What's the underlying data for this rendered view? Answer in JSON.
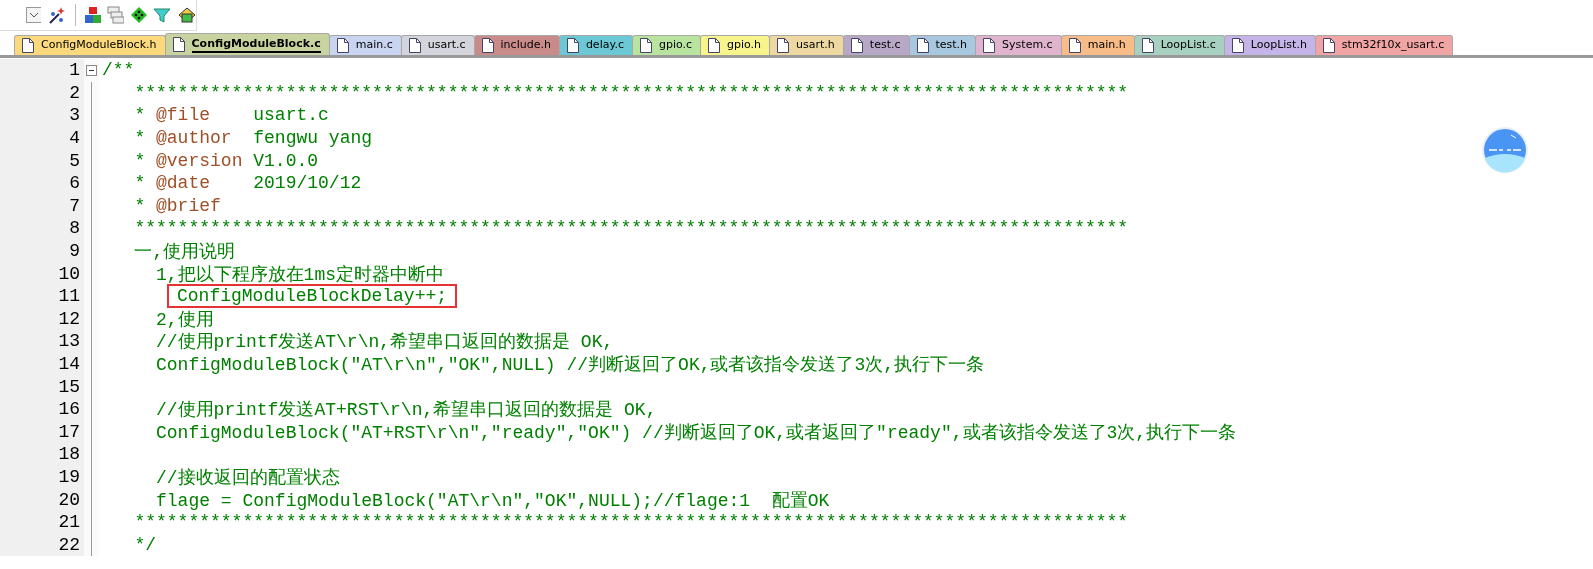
{
  "toolbar": {
    "items": [
      {
        "kind": "dropdown"
      },
      {
        "kind": "wand"
      },
      {
        "kind": "separator"
      },
      {
        "kind": "blocks"
      },
      {
        "kind": "windows"
      },
      {
        "kind": "diamond"
      },
      {
        "kind": "funnel"
      },
      {
        "kind": "stack"
      }
    ]
  },
  "tabs": [
    {
      "label": "ConfigModuleBlock.h",
      "color": "#fbd97c",
      "selected": false
    },
    {
      "label": "ConfigModuleBlock.c",
      "color": "#c8d4a0",
      "selected": true
    },
    {
      "label": "main.c",
      "color": "#c9d4f0",
      "selected": false
    },
    {
      "label": "usart.c",
      "color": "#d4d4dc",
      "selected": false
    },
    {
      "label": "include.h",
      "color": "#c98a8a",
      "selected": false
    },
    {
      "label": "delay.c",
      "color": "#6cc8d4",
      "selected": false
    },
    {
      "label": "gpio.c",
      "color": "#b8e4a0",
      "selected": false
    },
    {
      "label": "gpio.h",
      "color": "#f8f48c",
      "selected": false
    },
    {
      "label": "usart.h",
      "color": "#ecd8a0",
      "selected": false
    },
    {
      "label": "test.c",
      "color": "#b8a8c8",
      "selected": false
    },
    {
      "label": "test.h",
      "color": "#a8c8e0",
      "selected": false
    },
    {
      "label": "System.c",
      "color": "#e0b4cc",
      "selected": false
    },
    {
      "label": "main.h",
      "color": "#f8bc88",
      "selected": false
    },
    {
      "label": "LoopList.c",
      "color": "#a8d0c0",
      "selected": false
    },
    {
      "label": "LoopList.h",
      "color": "#c4b4e8",
      "selected": false
    },
    {
      "label": "stm32f10x_usart.c",
      "color": "#f0a4a4",
      "selected": false
    }
  ],
  "editor": {
    "lines": [
      {
        "number": "1",
        "fold": true,
        "segments": [
          {
            "kind": "comment",
            "text": "/**"
          }
        ]
      },
      {
        "number": "2",
        "segments": [
          {
            "kind": "comment",
            "text": "   ********************************************************************************************"
          }
        ]
      },
      {
        "number": "3",
        "segments": [
          {
            "kind": "comment",
            "text": "   * "
          },
          {
            "kind": "tag",
            "text": "@file"
          },
          {
            "kind": "comment",
            "text": "    usart.c"
          }
        ]
      },
      {
        "number": "4",
        "segments": [
          {
            "kind": "comment",
            "text": "   * "
          },
          {
            "kind": "tag",
            "text": "@author"
          },
          {
            "kind": "comment",
            "text": "  fengwu yang"
          }
        ]
      },
      {
        "number": "5",
        "segments": [
          {
            "kind": "comment",
            "text": "   * "
          },
          {
            "kind": "tag",
            "text": "@version"
          },
          {
            "kind": "comment",
            "text": " V1.0.0"
          }
        ]
      },
      {
        "number": "6",
        "segments": [
          {
            "kind": "comment",
            "text": "   * "
          },
          {
            "kind": "tag",
            "text": "@date"
          },
          {
            "kind": "comment",
            "text": "    2019/10/12"
          }
        ]
      },
      {
        "number": "7",
        "segments": [
          {
            "kind": "comment",
            "text": "   * "
          },
          {
            "kind": "tag",
            "text": "@brief"
          }
        ]
      },
      {
        "number": "8",
        "segments": [
          {
            "kind": "comment",
            "text": "   ********************************************************************************************"
          }
        ]
      },
      {
        "number": "9",
        "segments": [
          {
            "kind": "comment",
            "text": "   一,使用说明"
          }
        ]
      },
      {
        "number": "10",
        "segments": [
          {
            "kind": "comment",
            "text": "     1,把以下程序放在1ms定时器中断中"
          }
        ]
      },
      {
        "number": "11",
        "boxed": true,
        "segments": [
          {
            "kind": "comment",
            "text": "ConfigModuleBlockDelay++;"
          }
        ]
      },
      {
        "number": "12",
        "segments": [
          {
            "kind": "comment",
            "text": "     2,使用"
          }
        ]
      },
      {
        "number": "13",
        "segments": [
          {
            "kind": "comment",
            "text": "     //使用printf发送AT\\r\\n,希望串口返回的数据是 OK,"
          }
        ]
      },
      {
        "number": "14",
        "segments": [
          {
            "kind": "comment",
            "text": "     ConfigModuleBlock(\"AT\\r\\n\",\"OK\",NULL) //判断返回了OK,或者该指令发送了3次,执行下一条"
          }
        ]
      },
      {
        "number": "15"
      },
      {
        "number": "16",
        "segments": [
          {
            "kind": "comment",
            "text": "     //使用printf发送AT+RST\\r\\n,希望串口返回的数据是 OK,"
          }
        ]
      },
      {
        "number": "17",
        "segments": [
          {
            "kind": "comment",
            "text": "     ConfigModuleBlock(\"AT+RST\\r\\n\",\"ready\",\"OK\") //判断返回了OK,或者返回了\"ready\",或者该指令发送了3次,执行下一条"
          }
        ]
      },
      {
        "number": "18"
      },
      {
        "number": "19",
        "segments": [
          {
            "kind": "comment",
            "text": "     //接收返回的配置状态"
          }
        ]
      },
      {
        "number": "20",
        "segments": [
          {
            "kind": "comment",
            "text": "     flage = ConfigModuleBlock(\"AT\\r\\n\",\"OK\",NULL);//flage:1  配置OK"
          }
        ]
      },
      {
        "number": "21",
        "segments": [
          {
            "kind": "comment",
            "text": "   ********************************************************************************************"
          }
        ]
      },
      {
        "number": "22",
        "segments": [
          {
            "kind": "comment",
            "text": "   */"
          }
        ]
      }
    ]
  }
}
